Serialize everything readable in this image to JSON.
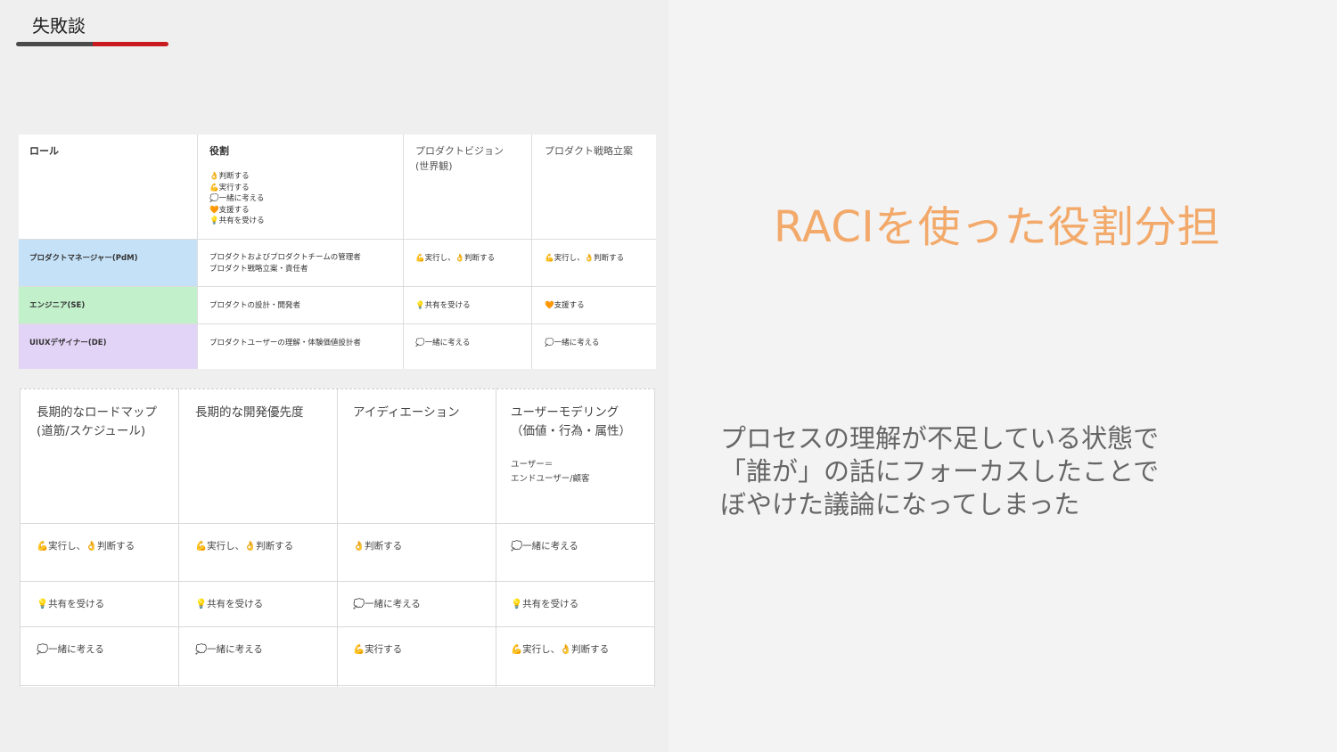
{
  "header": {
    "title": "失敗談"
  },
  "colors": {
    "accent_red": "#c81a1f",
    "title_orange": "#f2a96a",
    "pdm": "#c5e1f7",
    "se": "#c2f0cb",
    "de": "#e2d4f7"
  },
  "table1": {
    "headers": [
      "ロール",
      "役割",
      "プロダクトビジョン\n(世界観)",
      "プロダクト戦略立案"
    ],
    "legend": [
      "👌判断する",
      "💪実行する",
      "💭一緒に考える",
      "🧡支援する",
      "💡共有を受ける"
    ],
    "rows": [
      {
        "role": "プロダクトマネージャー(PdM)",
        "desc": "プロダクトおよびプロダクトチームの管理者\nプロダクト戦略立案・責任者",
        "vision": "💪実行し、👌判断する",
        "strategy": "💪実行し、👌判断する"
      },
      {
        "role": "エンジニア(SE)",
        "desc": "プロダクトの設計・開発者",
        "vision": "💡共有を受ける",
        "strategy": "🧡支援する"
      },
      {
        "role": "UIUXデザイナー(DE)",
        "desc": "プロダクトユーザーの理解・体験価値設計者",
        "vision": "💭一緒に考える",
        "strategy": "💭一緒に考える"
      }
    ]
  },
  "table2": {
    "headers": [
      "長期的なロードマップ\n(道筋/スケジュール)",
      "長期的な開発優先度",
      "アイディエーション",
      "ユーザーモデリング\n（価値・行為・属性）"
    ],
    "header_note": "ユーザー＝\nエンドユーザー/顧客",
    "rows": [
      [
        "💪実行し、👌判断する",
        "💪実行し、👌判断する",
        "👌判断する",
        "💭一緒に考える"
      ],
      [
        "💡共有を受ける",
        "💡共有を受ける",
        "💭一緒に考える",
        "💡共有を受ける"
      ],
      [
        "💭一緒に考える",
        "💭一緒に考える",
        "💪実行する",
        "💪実行し、👌判断する"
      ]
    ]
  },
  "slide": {
    "title": "RACIを使った役割分担",
    "body_lines": [
      "プロセスの理解が不足している状態で",
      "「誰が」の話にフォーカスしたことで",
      "ぼやけた議論になってしまった"
    ]
  }
}
